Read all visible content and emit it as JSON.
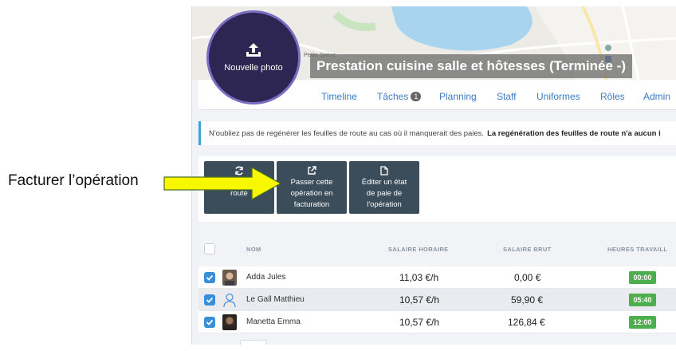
{
  "annotation": {
    "label": "Facturer l’opération",
    "arrow_color": "#f7f700"
  },
  "header": {
    "photo_label": "Nouvelle photo",
    "map_label": "Petite Sirène",
    "title": "Prestation cuisine salle et hôtesses (Terminée -)"
  },
  "tabs": [
    {
      "label": "Timeline"
    },
    {
      "label": "Tâches",
      "badge": "1"
    },
    {
      "label": "Planning"
    },
    {
      "label": "Staff"
    },
    {
      "label": "Uniformes"
    },
    {
      "label": "Rôles"
    },
    {
      "label": "Admin"
    }
  ],
  "notice": {
    "text": "N'oubliez pas de regénérer les feuilles de route au cas où il manquerait des paies.",
    "bold": "La regénération des feuilles de route n'a aucun i"
  },
  "actions": [
    {
      "icon": "refresh-icon",
      "label": "feuilles d\nroute"
    },
    {
      "icon": "external-link-icon",
      "label": "Passer cette\nopération en\nfacturation"
    },
    {
      "icon": "file-icon",
      "label": "Éditer un état\nde paie de\nl'opération"
    }
  ],
  "table": {
    "headers": {
      "name": "NOM",
      "hourly": "SALAIRE HORAIRE",
      "gross": "SALAIRE BRUT",
      "hours": "HEURES TRAVAILL"
    },
    "rows": [
      {
        "name": "Adda Jules",
        "hourly": "11,03 €/h",
        "gross": "0,00 €",
        "hours": "00:00",
        "checked": true
      },
      {
        "name": "Le Gall Matthieu",
        "hourly": "10,57 €/h",
        "gross": "59,90 €",
        "hours": "05:40",
        "checked": true
      },
      {
        "name": "Manetta Emma",
        "hourly": "10,57 €/h",
        "gross": "126,84 €",
        "hours": "12:00",
        "checked": true
      }
    ]
  },
  "colors": {
    "button_bg": "#3b4c5a",
    "accent_blue": "#3a8fd8",
    "hours_green": "#4cae4c",
    "avatar_circle": "#2d2552"
  }
}
